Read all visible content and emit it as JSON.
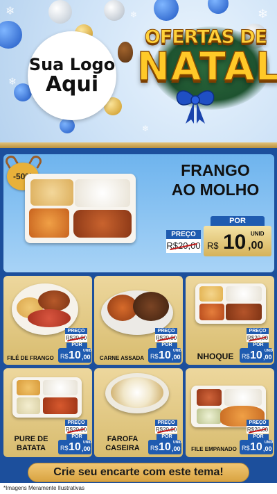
{
  "header": {
    "logo_line1": "Sua Logo",
    "logo_line2": "Aqui",
    "title_top": "OFERTAS DE",
    "title_main": "NATAL"
  },
  "feature": {
    "discount": "-50%",
    "title_line1": "FRANGO",
    "title_line2": "AO MOLHO",
    "preco_label": "PREÇO",
    "old_price": "R$20,00",
    "por_label": "POR",
    "currency": "R$",
    "price_int": "10",
    "price_cents": ",00",
    "unit": "UNID"
  },
  "cards": [
    {
      "name": "FILÉ DE FRANGO",
      "preco_label": "PREÇO",
      "old_price": "R$20,00",
      "por_label": "POR",
      "currency": "R$",
      "price_int": "10",
      "price_cents": ",00",
      "unit": "UNID"
    },
    {
      "name": "CARNE ASSADA",
      "preco_label": "PREÇO",
      "old_price": "R$20,00",
      "por_label": "POR",
      "currency": "R$",
      "price_int": "10",
      "price_cents": ",00",
      "unit": "UNID"
    },
    {
      "name": "NHOQUE",
      "preco_label": "PREÇO",
      "old_price": "R$20,00",
      "por_label": "POR",
      "currency": "R$",
      "price_int": "10",
      "price_cents": ",00",
      "unit": "UNID"
    },
    {
      "name_line1": "PURE DE",
      "name_line2": "BATATA",
      "preco_label": "PREÇO",
      "old_price": "R$20,00",
      "por_label": "POR",
      "currency": "R$",
      "price_int": "10",
      "price_cents": ",00",
      "unit": "UNID"
    },
    {
      "name_line1": "FAROFA",
      "name_line2": "CASEIRA",
      "preco_label": "PREÇO",
      "old_price": "R$20,00",
      "por_label": "POR",
      "currency": "R$",
      "price_int": "10",
      "price_cents": ",00",
      "unit": "UNID"
    },
    {
      "name": "FILE EMPANADO",
      "preco_label": "PREÇO",
      "old_price": "R$20,00",
      "por_label": "POR",
      "currency": "R$",
      "price_int": "10",
      "price_cents": ",00",
      "unit": "UNID"
    }
  ],
  "cta": "Crie seu encarte com este tema!",
  "footnote": "*Imagens Meramente Ilustrativas",
  "colors": {
    "primary_blue": "#1c4f9c",
    "price_blue": "#1f5bb0",
    "gold": "#e8b13a",
    "card_bg": "#ecd59a"
  }
}
